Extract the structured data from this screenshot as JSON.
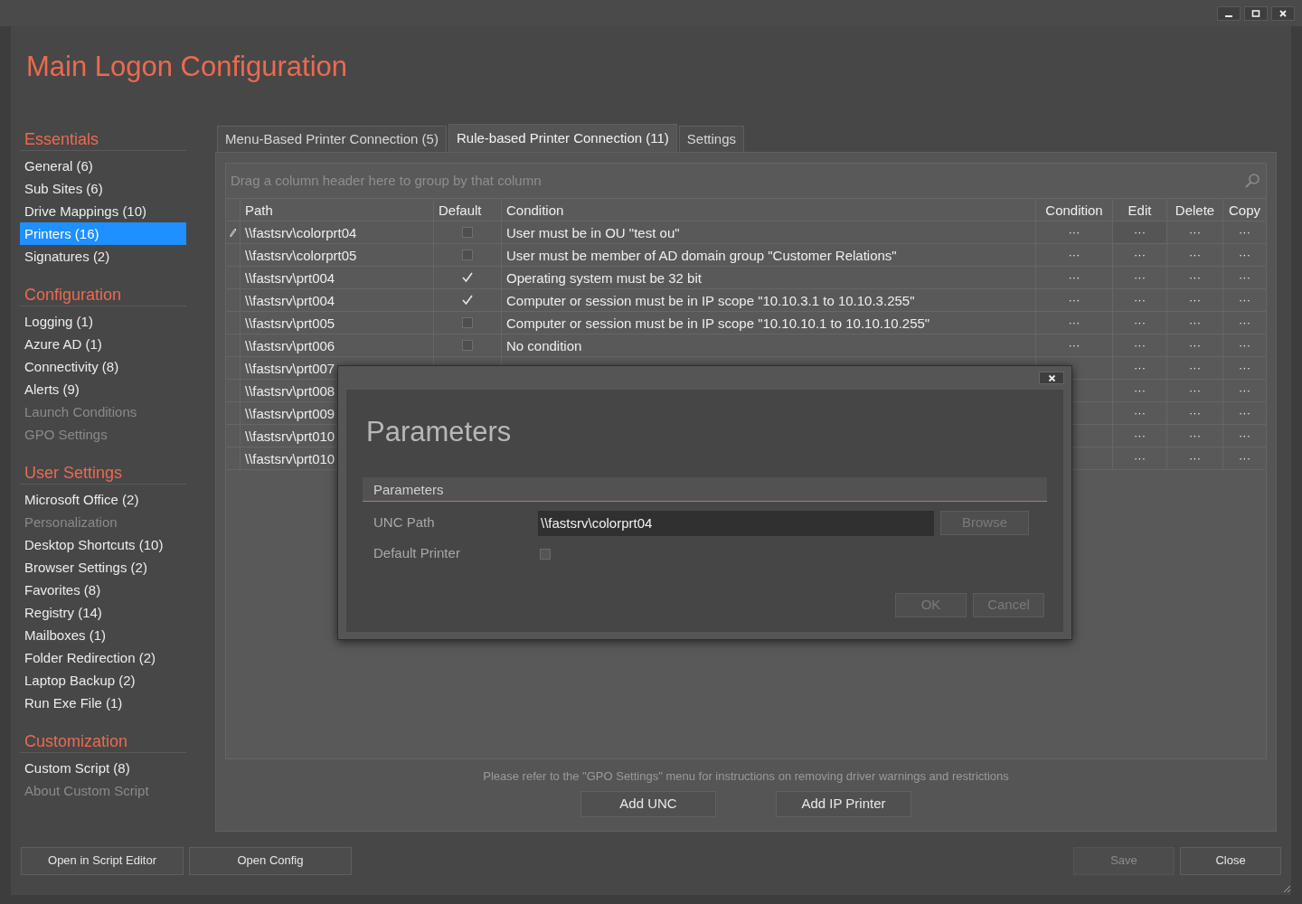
{
  "window": {
    "title": "Main Logon Configuration"
  },
  "sidebar": [
    {
      "heading": "Essentials",
      "items": [
        {
          "label": "General (6)",
          "selected": false,
          "disabled": false
        },
        {
          "label": "Sub Sites (6)",
          "selected": false,
          "disabled": false
        },
        {
          "label": "Drive Mappings (10)",
          "selected": false,
          "disabled": false
        },
        {
          "label": "Printers (16)",
          "selected": true,
          "disabled": false
        },
        {
          "label": "Signatures (2)",
          "selected": false,
          "disabled": false
        }
      ]
    },
    {
      "heading": "Configuration",
      "items": [
        {
          "label": "Logging (1)",
          "selected": false,
          "disabled": false
        },
        {
          "label": "Azure AD (1)",
          "selected": false,
          "disabled": false
        },
        {
          "label": "Connectivity (8)",
          "selected": false,
          "disabled": false
        },
        {
          "label": "Alerts (9)",
          "selected": false,
          "disabled": false
        },
        {
          "label": "Launch Conditions",
          "selected": false,
          "disabled": true
        },
        {
          "label": "GPO Settings",
          "selected": false,
          "disabled": true
        }
      ]
    },
    {
      "heading": "User Settings",
      "items": [
        {
          "label": "Microsoft Office (2)",
          "selected": false,
          "disabled": false
        },
        {
          "label": "Personalization",
          "selected": false,
          "disabled": true
        },
        {
          "label": "Desktop Shortcuts (10)",
          "selected": false,
          "disabled": false
        },
        {
          "label": "Browser Settings (2)",
          "selected": false,
          "disabled": false
        },
        {
          "label": "Favorites (8)",
          "selected": false,
          "disabled": false
        },
        {
          "label": "Registry (14)",
          "selected": false,
          "disabled": false
        },
        {
          "label": "Mailboxes (1)",
          "selected": false,
          "disabled": false
        },
        {
          "label": "Folder Redirection (2)",
          "selected": false,
          "disabled": false
        },
        {
          "label": "Laptop Backup (2)",
          "selected": false,
          "disabled": false
        },
        {
          "label": "Run Exe File (1)",
          "selected": false,
          "disabled": false
        }
      ]
    },
    {
      "heading": "Customization",
      "items": [
        {
          "label": "Custom Script (8)",
          "selected": false,
          "disabled": false
        },
        {
          "label": "About Custom Script",
          "selected": false,
          "disabled": true
        }
      ]
    }
  ],
  "tabs": [
    {
      "label": "Menu-Based Printer Connection (5)",
      "selected": false
    },
    {
      "label": "Rule-based Printer Connection (11)",
      "selected": true
    },
    {
      "label": "Settings",
      "selected": false
    }
  ],
  "grid": {
    "group_hint": "Drag a column header here to group by that column",
    "columns": [
      "Path",
      "Default",
      "Condition",
      "Condition",
      "Edit",
      "Delete",
      "Copy"
    ],
    "rows": [
      {
        "current": true,
        "path": "\\\\fastsrv\\colorprt04",
        "default": false,
        "condition": "User must be in OU \"test ou\"",
        "condition_action": "···",
        "edit_action": "···",
        "delete_action": "···",
        "copy_action": "···"
      },
      {
        "current": false,
        "path": "\\\\fastsrv\\colorprt05",
        "default": false,
        "condition": "User must be member of AD domain group \"Customer Relations\"",
        "condition_action": "···",
        "edit_action": "···",
        "delete_action": "···",
        "copy_action": "···"
      },
      {
        "current": false,
        "path": "\\\\fastsrv\\prt004",
        "default": true,
        "condition": "Operating system must be 32 bit",
        "condition_action": "···",
        "edit_action": "···",
        "delete_action": "···",
        "copy_action": "···"
      },
      {
        "current": false,
        "path": "\\\\fastsrv\\prt004",
        "default": true,
        "condition": "Computer or session must be in IP scope \"10.10.3.1 to 10.10.3.255\"",
        "condition_action": "···",
        "edit_action": "···",
        "delete_action": "···",
        "copy_action": "···"
      },
      {
        "current": false,
        "path": "\\\\fastsrv\\prt005",
        "default": false,
        "condition": "Computer or session must be in IP scope \"10.10.10.1 to 10.10.10.255\"",
        "condition_action": "···",
        "edit_action": "···",
        "delete_action": "···",
        "copy_action": "···"
      },
      {
        "current": false,
        "path": "\\\\fastsrv\\prt006",
        "default": false,
        "condition": "No condition",
        "condition_action": "···",
        "edit_action": "···",
        "delete_action": "···",
        "copy_action": "···"
      },
      {
        "current": false,
        "path": "\\\\fastsrv\\prt007",
        "edit_action": "···",
        "delete_action": "···",
        "copy_action": "···"
      },
      {
        "current": false,
        "path": "\\\\fastsrv\\prt008",
        "edit_action": "···",
        "delete_action": "···",
        "copy_action": "···"
      },
      {
        "current": false,
        "path": "\\\\fastsrv\\prt009",
        "edit_action": "···",
        "delete_action": "···",
        "copy_action": "···"
      },
      {
        "current": false,
        "path": "\\\\fastsrv\\prt010",
        "edit_action": "···",
        "delete_action": "···",
        "copy_action": "···"
      },
      {
        "current": false,
        "path": "\\\\fastsrv\\prt010",
        "edit_action": "···",
        "delete_action": "···",
        "copy_action": "···"
      }
    ]
  },
  "note": "Please refer to the \"GPO Settings\" menu for instructions on removing driver warnings and restrictions",
  "panel_buttons": [
    "Add UNC",
    "Add IP Printer"
  ],
  "footer_buttons_left": [
    {
      "label": "Open in Script Editor",
      "disabled": false
    },
    {
      "label": "Open Config",
      "disabled": false
    }
  ],
  "footer_buttons_right": [
    {
      "label": "Save",
      "disabled": true
    },
    {
      "label": "Close",
      "disabled": false
    }
  ],
  "dialog": {
    "title": "Parameters",
    "section": "Parameters",
    "fields": [
      {
        "kind": "text",
        "label": "UNC Path",
        "value": "\\\\fastsrv\\colorprt04",
        "button": {
          "label": "Browse",
          "disabled": true
        }
      },
      {
        "kind": "checkbox",
        "label": "Default Printer",
        "checked": false
      }
    ],
    "buttons": [
      {
        "label": "OK",
        "disabled": true
      },
      {
        "label": "Cancel",
        "disabled": true
      }
    ]
  }
}
